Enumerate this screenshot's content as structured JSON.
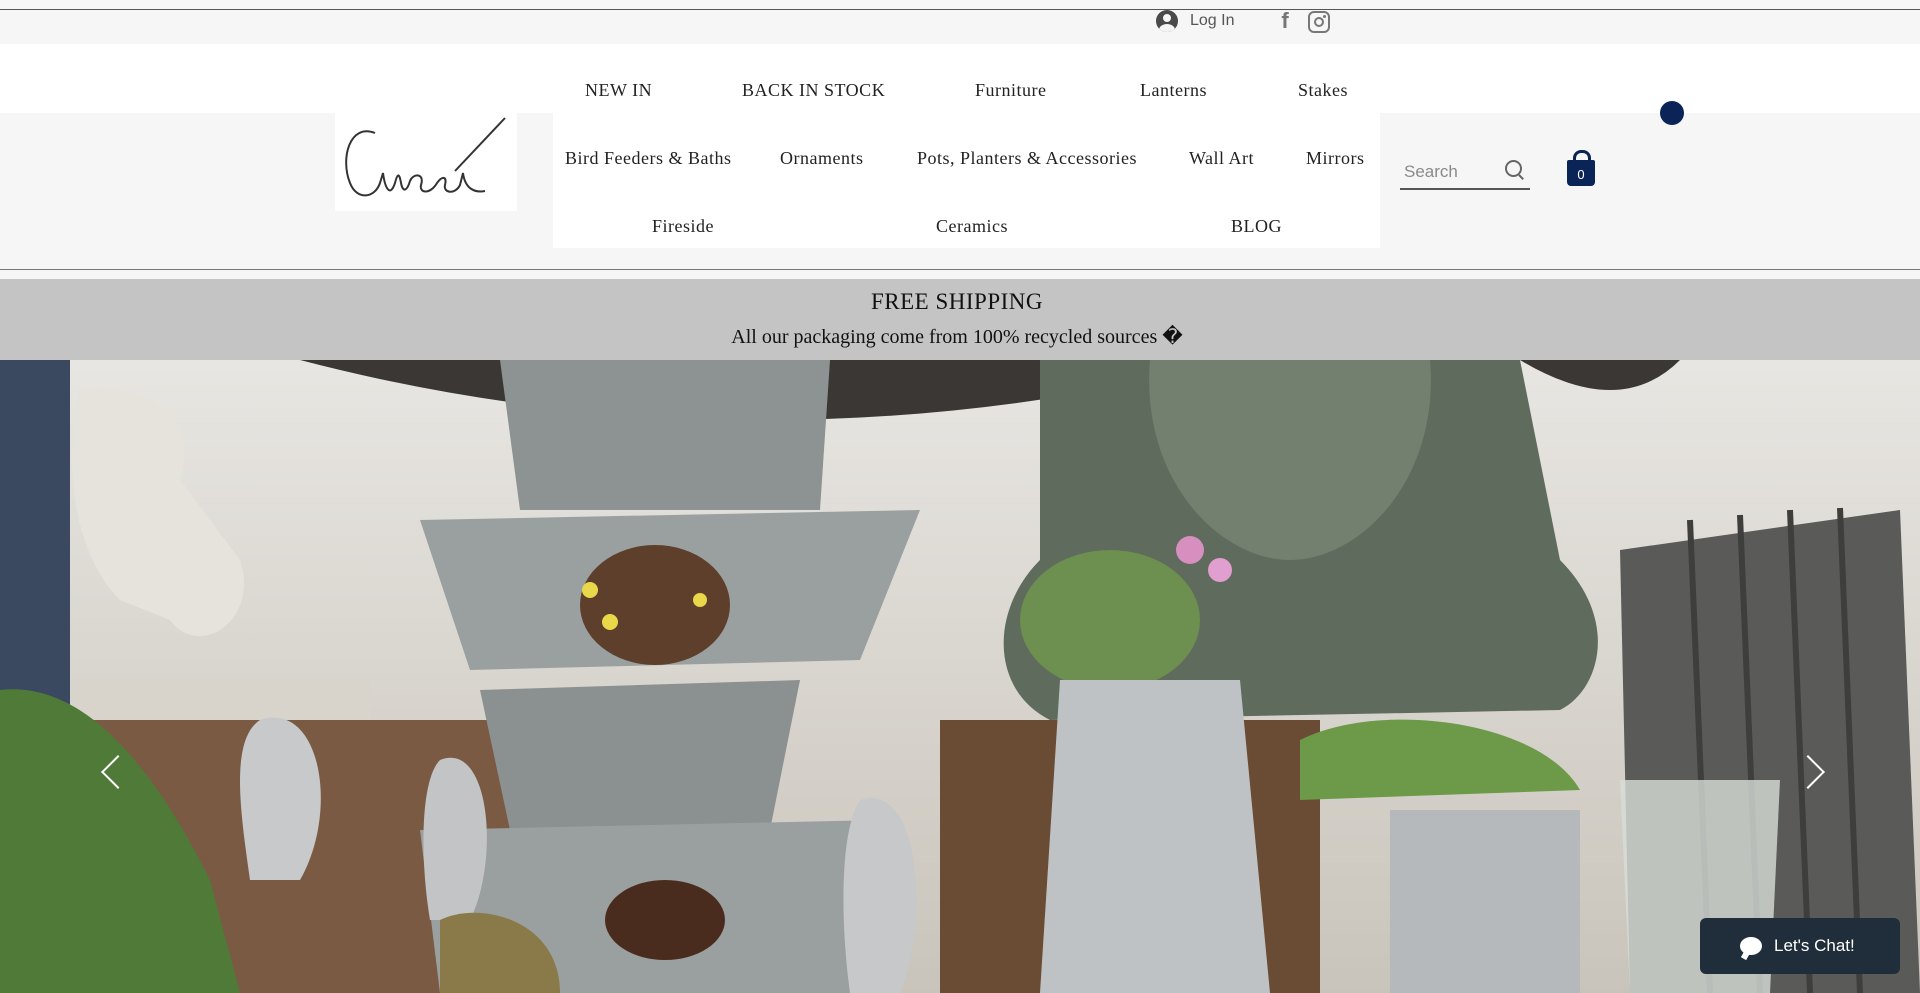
{
  "topbar": {
    "login_label": "Log In",
    "social": [
      "facebook-icon",
      "instagram-icon"
    ]
  },
  "nav": {
    "row1": [
      "NEW IN",
      "BACK IN STOCK",
      "Furniture",
      "Lanterns",
      "Stakes"
    ],
    "row2": [
      "Bird Feeders & Baths",
      "Ornaments",
      "Pots, Planters & Accessories",
      "Wall Art",
      "Mirrors"
    ],
    "row3": [
      "Fireside",
      "Ceramics",
      "BLOG"
    ]
  },
  "search": {
    "placeholder": "Search"
  },
  "cart": {
    "count": "0",
    "badge_count": "0",
    "accent": "#0a2458"
  },
  "banner": {
    "title": "FREE SHIPPING",
    "subtitle": "All our packaging come from 100% recycled sources �"
  },
  "chat": {
    "label": "Let's Chat!"
  }
}
